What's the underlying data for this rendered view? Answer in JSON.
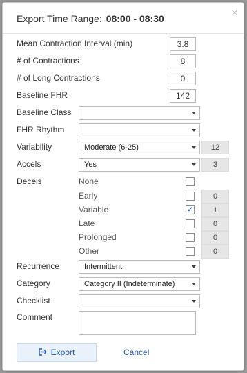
{
  "dialog": {
    "title_prefix": "Export Time Range:",
    "time_range": "08:00 - 08:30",
    "close_glyph": "×"
  },
  "fields": {
    "mean_contraction_interval": {
      "label": "Mean Contraction Interval (min)",
      "value": "3.8"
    },
    "contractions": {
      "label": "# of Contractions",
      "value": "8"
    },
    "long_contractions": {
      "label": "# of Long Contractions",
      "value": "0"
    },
    "baseline_fhr": {
      "label": "Baseline FHR",
      "value": "142"
    },
    "baseline_class": {
      "label": "Baseline Class",
      "value": ""
    },
    "fhr_rhythm": {
      "label": "FHR Rhythm",
      "value": ""
    },
    "variability": {
      "label": "Variability",
      "value": "Moderate (6-25)",
      "count": "12"
    },
    "accels": {
      "label": "Accels",
      "value": "Yes",
      "count": "3"
    },
    "decels": {
      "label": "Decels",
      "options": [
        {
          "label": "None",
          "checked": false,
          "count": ""
        },
        {
          "label": "Early",
          "checked": false,
          "count": "0"
        },
        {
          "label": "Variable",
          "checked": true,
          "count": "1"
        },
        {
          "label": "Late",
          "checked": false,
          "count": "0"
        },
        {
          "label": "Prolonged",
          "checked": false,
          "count": "0"
        },
        {
          "label": "Other",
          "checked": false,
          "count": "0"
        }
      ]
    },
    "recurrence": {
      "label": "Recurrence",
      "value": "Intermittent"
    },
    "category": {
      "label": "Category",
      "value": "Category II (Indeterminate)"
    },
    "checklist": {
      "label": "Checklist",
      "value": ""
    },
    "comment": {
      "label": "Comment",
      "value": ""
    }
  },
  "actions": {
    "export_label": "Export",
    "export_icon": "export-icon",
    "cancel_label": "Cancel"
  },
  "colors": {
    "accent": "#2a5ea8",
    "export_bg": "#e9f1fb",
    "count_bg": "#e6e6e6"
  }
}
